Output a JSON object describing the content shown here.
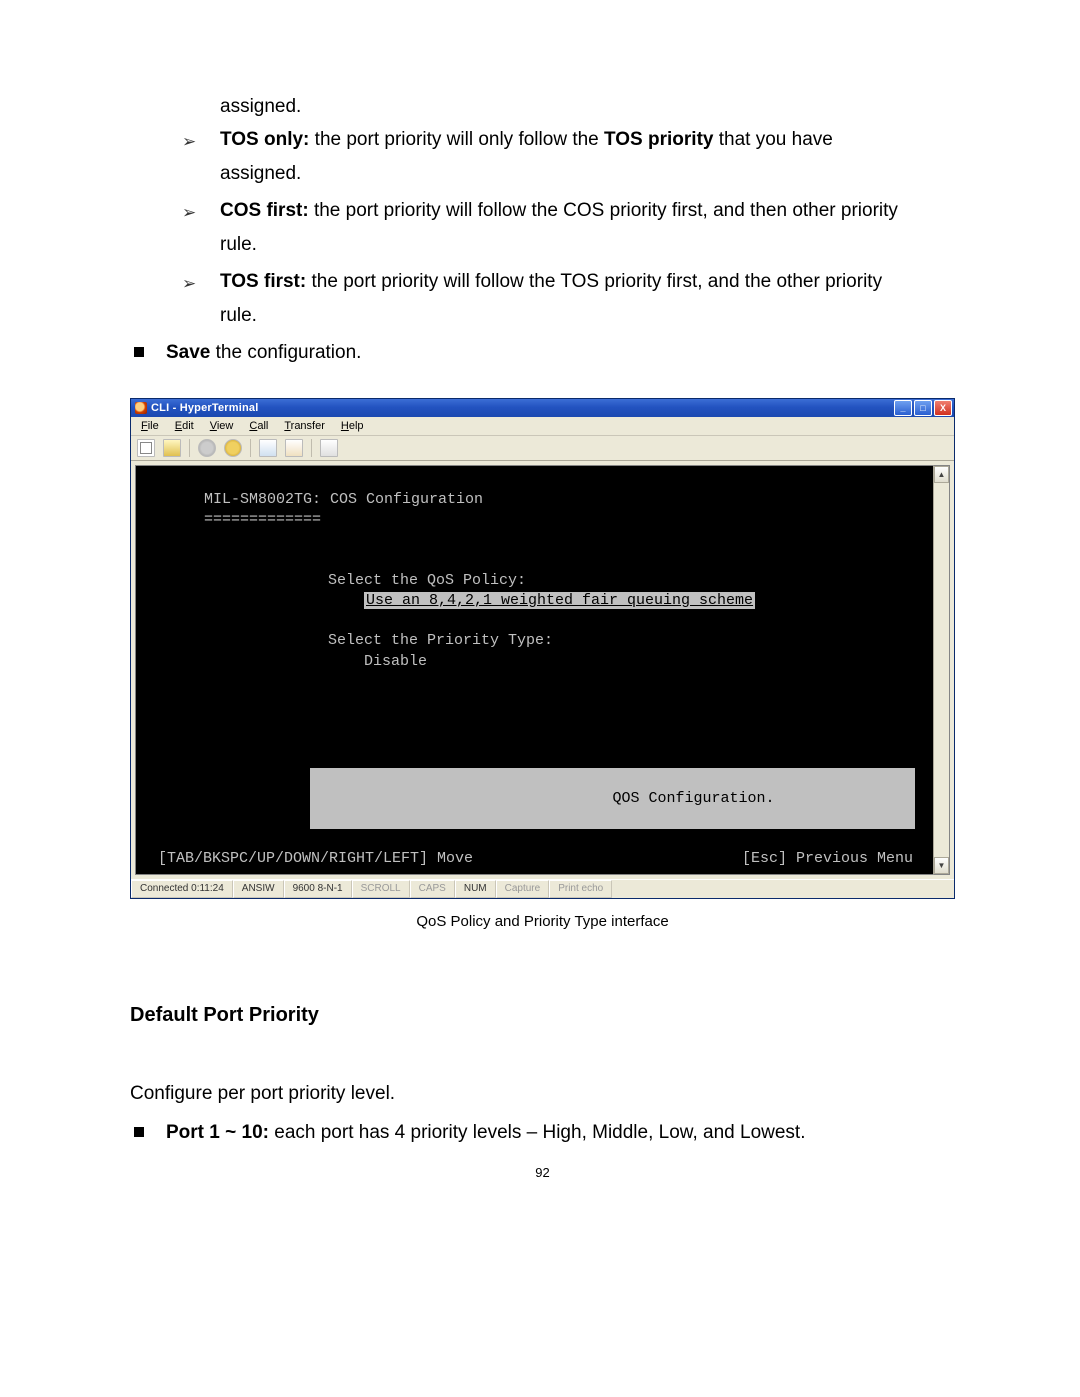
{
  "doc": {
    "assigned_line": "assigned.",
    "tos_only_label": "TOS only:",
    "tos_only_text": " the port priority will only follow the ",
    "tos_only_bold2": "TOS priority",
    "tos_only_tail": " that you have",
    "tos_only_line2": "assigned.",
    "cos_first_label": "COS first:",
    "cos_first_text": " the port priority will follow the COS priority first, and then other priority",
    "cos_first_line2": "rule.",
    "tos_first_label": "TOS first:",
    "tos_first_text": " the port priority will follow the TOS priority first, and the other priority",
    "tos_first_line2": "rule.",
    "save_bold": "Save",
    "save_tail": " the configuration.",
    "caption": "QoS Policy and Priority Type interface",
    "section_heading": "Default Port Priority",
    "configure_line": "Configure per port priority level.",
    "port_label": "Port 1 ~ 10:",
    "port_text": " each port has 4 priority levels – High, Middle, Low, and Lowest.",
    "page_number": "92"
  },
  "ht": {
    "title": "CLI - HyperTerminal",
    "menu": {
      "file": "File",
      "edit": "Edit",
      "view": "View",
      "call": "Call",
      "transfer": "Transfer",
      "help": "Help"
    },
    "term": {
      "header": "MIL-SM8002TG: COS Configuration",
      "divider": "=============",
      "qos_label": "Select the QoS Policy:",
      "qos_value": "Use an 8,4,2,1 weighted fair queuing scheme",
      "prio_label": "Select the Priority Type:",
      "prio_value": "Disable",
      "footer_center": "QOS Configuration.",
      "footer_left": "[TAB/BKSPC/UP/DOWN/RIGHT/LEFT] Move",
      "footer_right": "[Esc] Previous Menu"
    },
    "status": {
      "connected": "Connected 0:11:24",
      "emul": "ANSIW",
      "baud": "9600 8-N-1",
      "scroll": "SCROLL",
      "caps": "CAPS",
      "num": "NUM",
      "capture": "Capture",
      "echo": "Print echo"
    }
  }
}
